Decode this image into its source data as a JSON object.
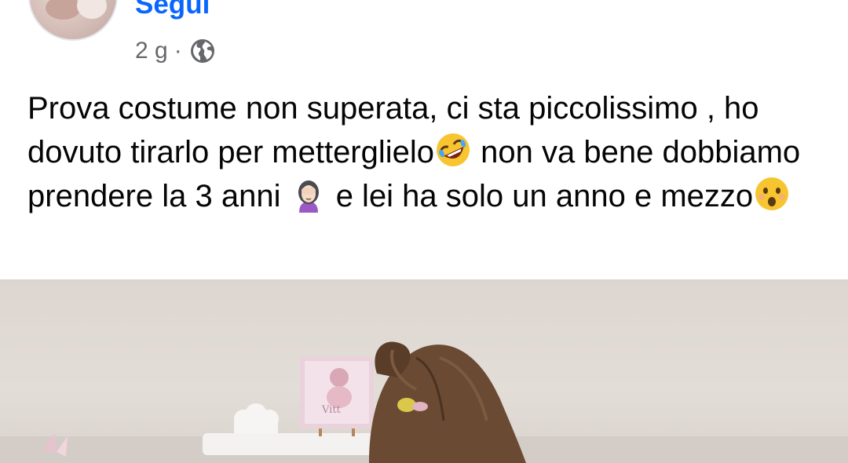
{
  "header": {
    "follow_label": "Segui",
    "age": "2 g",
    "separator": "·",
    "privacy_icon": "globe-icon"
  },
  "post": {
    "text_parts": [
      "Prova costume non superata, ci sta piccolissimo , ho dovuto tirarlo per metterglielo",
      " non va bene dobbiamo prendere la 3 anni ",
      " e lei ha solo un anno e mezzo"
    ],
    "emojis": [
      "rolling-on-floor-laughing-icon",
      "woman-facepalming-icon",
      "hushed-face-icon"
    ]
  },
  "photo": {
    "sign_text": "Vitt"
  },
  "colors": {
    "link": "#0866ff",
    "meta": "#65676b",
    "text": "#050505"
  }
}
